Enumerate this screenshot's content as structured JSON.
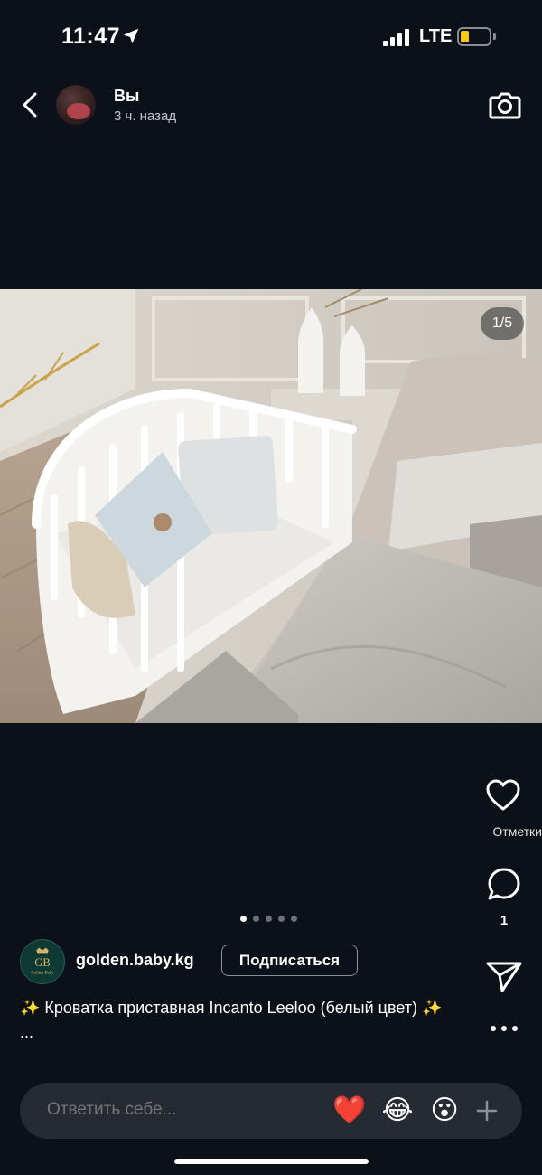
{
  "status": {
    "time": "11:47",
    "network": "LTE",
    "location_icon": "location-arrow-icon",
    "battery_color": "#f6c915"
  },
  "header": {
    "user": "Вы",
    "time_ago": "3 ч. назад",
    "back_icon": "chevron-left-icon",
    "camera_icon": "camera-icon"
  },
  "photo": {
    "counter": "1/5",
    "description_icon": "photo-bedside-crib"
  },
  "actions": {
    "likes_label": "Отметки",
    "comments_count": "1",
    "icons": [
      "heart-icon",
      "comment-icon",
      "share-icon",
      "more-icon"
    ]
  },
  "carousel": {
    "total": 5,
    "active": 1
  },
  "account": {
    "name": "golden.baby.kg",
    "follow_label": "Подписаться",
    "logo_text": "GB",
    "logo_subtext": "Golden Baby"
  },
  "caption": {
    "text": "✨ Кроватка приставная Incanto Leeloo (белый цвет) ✨ ..."
  },
  "reply": {
    "placeholder": "Ответить себе...",
    "emojis": [
      "❤️",
      "😂",
      "😮"
    ]
  },
  "colors": {
    "background": "#0c1018",
    "reply_bar": "#262a33",
    "accent_battery": "#f6c915"
  }
}
